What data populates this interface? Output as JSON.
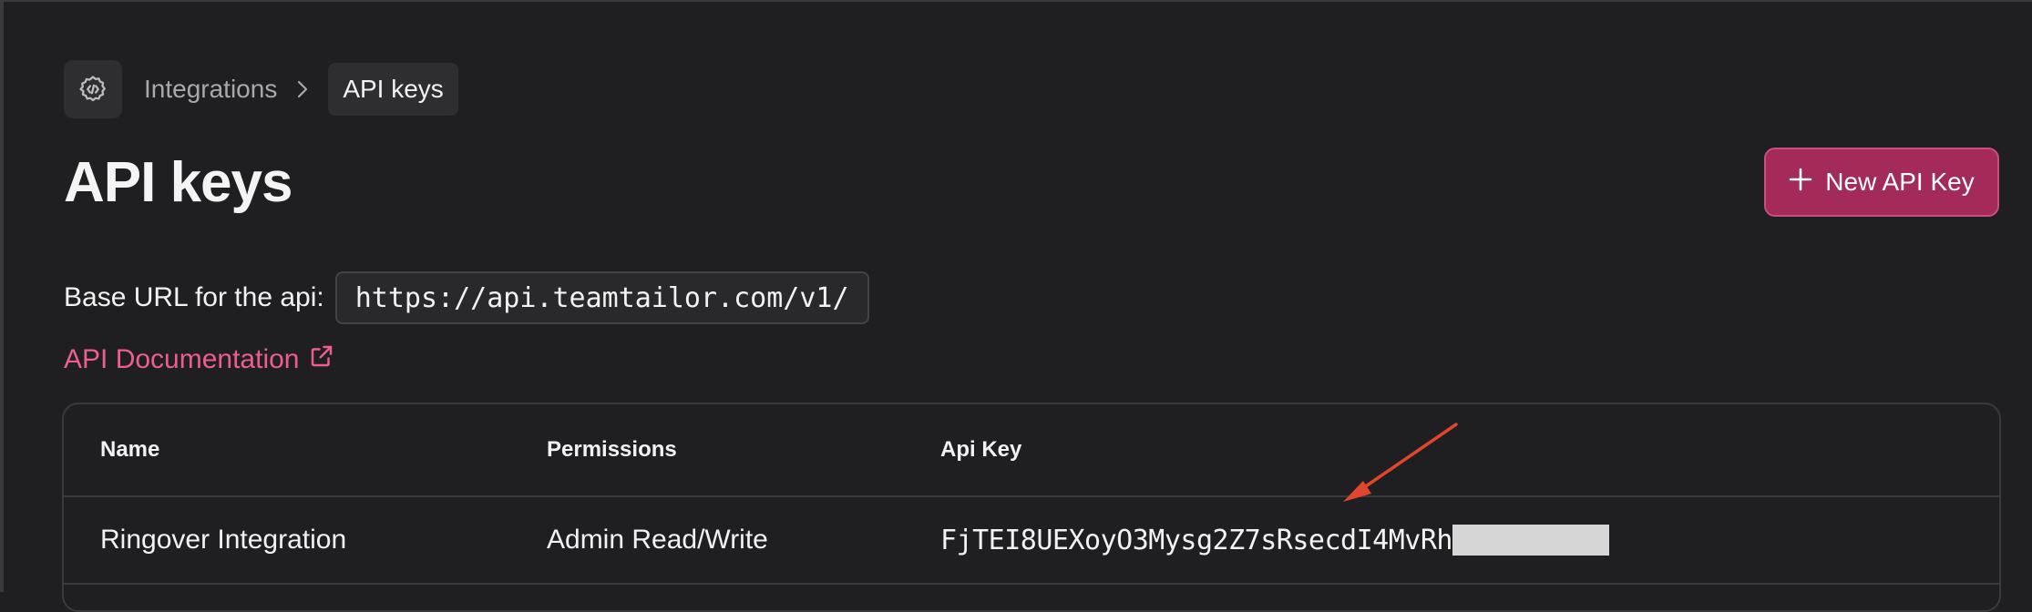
{
  "breadcrumb": {
    "icon": "code-gear-icon",
    "parent": "Integrations",
    "current": "API keys"
  },
  "page": {
    "title": "API keys",
    "new_button_label": "New API Key"
  },
  "base_url": {
    "label": "Base URL for the api:",
    "value": "https://api.teamtailor.com/v1/"
  },
  "docs_link": {
    "label": "API Documentation",
    "icon": "external-link-icon"
  },
  "table": {
    "columns": [
      "Name",
      "Permissions",
      "Api Key"
    ],
    "rows": [
      {
        "name": "Ringover Integration",
        "permissions": "Admin Read/Write",
        "api_key": "FjTEI8UEXoyO3Mysg2Z7sRsecdI4MvRh"
      }
    ]
  },
  "colors": {
    "background": "#1f1f21",
    "accent_button": "#a42a5a",
    "link": "#ec5d92",
    "annotation_arrow": "#e0452e",
    "redaction": "#d6d6d6"
  }
}
